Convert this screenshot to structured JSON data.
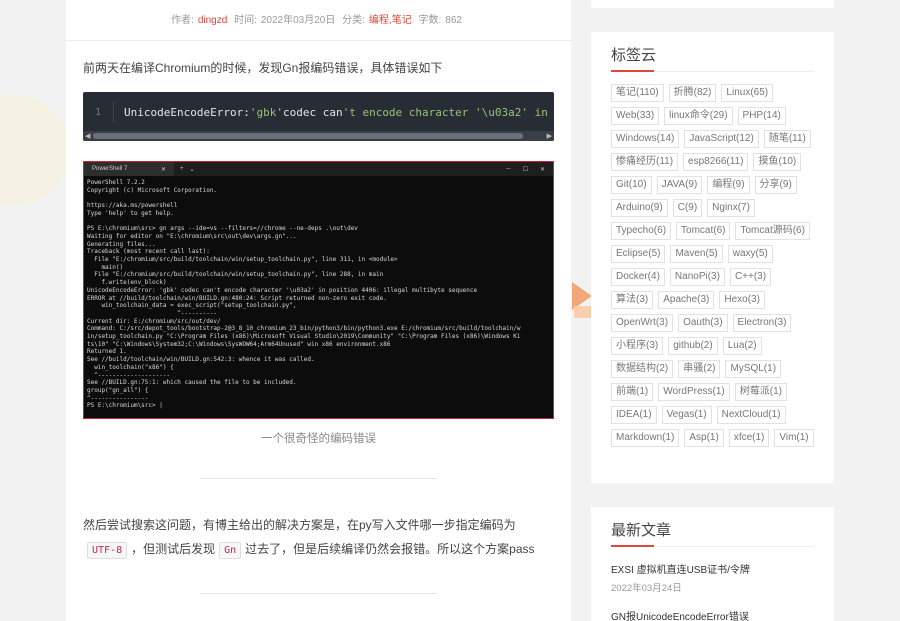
{
  "meta": {
    "author_label": "作者:",
    "author": "dingzd",
    "time_label": "时间:",
    "time": "2022年03月20日",
    "category_label": "分类:",
    "category": "编程,笔记",
    "wordcount_label": "字数:",
    "wordcount": "862"
  },
  "article": {
    "intro": "前两天在编译Chromium的时候，发现Gn报编码错误，具体错误如下",
    "code": {
      "line_number": "1",
      "part1": "UnicodeEncodeError: ",
      "part2": "'gbk'",
      "part3": " codec can",
      "part4": "'t encode character '",
      "part5": "\\u03a2",
      "part6": "' in posit"
    },
    "terminal": {
      "tab_title": "PowerShell 7",
      "text": "PowerShell 7.2.2\nCopyright (c) Microsoft Corporation.\n\nhttps://aka.ms/powershell\nType 'help' to get help.\n\nPS E:\\chromium\\src> gn args --ide=vs --filters=//chrome --ne-deps .\\out\\dev\nWaiting for editor on \"E:\\chromium\\src\\out\\dev\\args.gn\"...\nGenerating files...\nTraceback (most recent call last):\n  File \"E:/chromium/src/build/toolchain/win/setup_toolchain.py\", line 311, in <module>\n    main()\n  File \"E:/chromium/src/build/toolchain/win/setup_toolchain.py\", line 288, in main\n    f.write(env_block)\nUnicodeEncodeError: 'gbk' codec can't encode character '\\u03a2' in position 4406: illegal multibyte sequence\nERROR at //build/toolchain/win/BUILD.gn:480:24: Script returned non-zero exit code.\n    win_toolchain_data = exec_script(\"setup_toolchain.py\",\n                         ^----------\nCurrent dir: E:/chromium/src/out/dev/\nCommand: C:/src/depot_tools/bootstrap-2@3_8_10_chromium_23_bin/python3/bin/python3.exe E:/chromium/src/build/toolchain/w\nin/setup_toolchain.py \"C:\\Program Files (x86)\\Microsoft Visual Studio\\2019\\Community\" \"C:\\Program Files (x86)\\Windows Ki\nts\\10\" \"C:\\Windows\\System32;C:\\Windows\\SysWOW64;Arm64Unused\" win x86 environment.x86\nReturned 1.\nSee //build/toolchain/win/BUILD.gn:542:3: whence it was called.\n  win_toolchain(\"x86\") {\n  ^--------------------\nSee //BUILD.gn:75:1: which caused the file to be included.\ngroup(\"gn_all\") {\n^----------------\nPS E:\\chromium\\src> |"
    },
    "caption": "一个很奇怪的编码错误",
    "para2_a": "然后尝试搜索这问题，有博主给出的解决方案是，在py写入文件哪一步指定编码为",
    "code_utf8": "UTF-8",
    "para2_b": "，但测试后发现",
    "code_gn": "Gn",
    "para2_c": "过去了，但是后续编译仍然会报错。所以这个方案pass"
  },
  "sidebar": {
    "tags_title": "标签云",
    "tags": [
      "笔记(110)",
      "折腾(82)",
      "Linux(65)",
      "Web(33)",
      "linux命令(29)",
      "PHP(14)",
      "Windows(14)",
      "JavaScript(12)",
      "随笔(11)",
      "惨痛经历(11)",
      "esp8266(11)",
      "摸鱼(10)",
      "Git(10)",
      "JAVA(9)",
      "编程(9)",
      "分享(9)",
      "Arduino(9)",
      "C(9)",
      "Nginx(7)",
      "Typecho(6)",
      "Tomcat(6)",
      "Tomcat源码(6)",
      "Eclipse(5)",
      "Maven(5)",
      "waxy(5)",
      "Docker(4)",
      "NanoPi(3)",
      "C++(3)",
      "算法(3)",
      "Apache(3)",
      "Hexo(3)",
      "OpenWrt(3)",
      "Oauth(3)",
      "Electron(3)",
      "小程序(3)",
      "github(2)",
      "Lua(2)",
      "数据结构(2)",
      "串骚(2)",
      "MySQL(1)",
      "前端(1)",
      "WordPress(1)",
      "树莓派(1)",
      "IDEA(1)",
      "Vegas(1)",
      "NextCloud(1)",
      "Markdown(1)",
      "Asp(1)",
      "xfce(1)",
      "Vim(1)"
    ],
    "recent_title": "最新文章",
    "recent": [
      {
        "title": "EXSI 虚拟机直连USB证书/令牌",
        "date": "2022年03月24日"
      },
      {
        "title": "GN报UnicodeEncodeError错误",
        "date": ""
      }
    ]
  },
  "colors": {
    "accent": "#e0463a",
    "background": "#f2f2f2"
  }
}
